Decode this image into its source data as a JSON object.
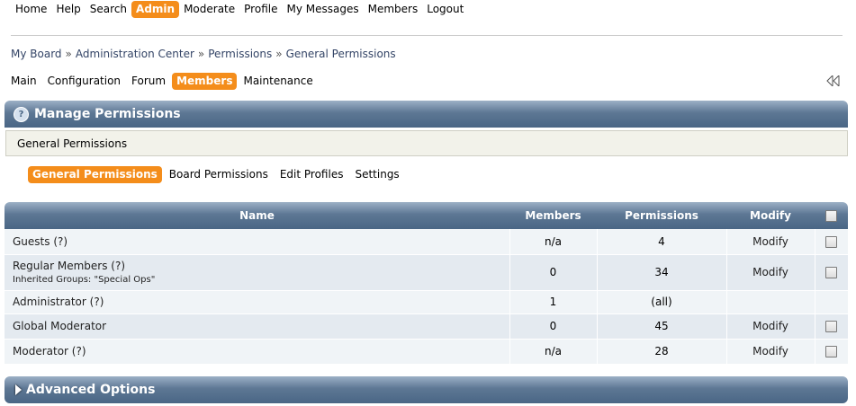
{
  "topnav": [
    {
      "label": "Home",
      "active": false
    },
    {
      "label": "Help",
      "active": false
    },
    {
      "label": "Search",
      "active": false
    },
    {
      "label": "Admin",
      "active": true
    },
    {
      "label": "Moderate",
      "active": false
    },
    {
      "label": "Profile",
      "active": false
    },
    {
      "label": "My Messages",
      "active": false
    },
    {
      "label": "Members",
      "active": false
    },
    {
      "label": "Logout",
      "active": false
    }
  ],
  "breadcrumb": [
    "My Board",
    "Administration Center",
    "Permissions",
    "General Permissions"
  ],
  "breadcrumb_separator": "»",
  "adminnav": [
    {
      "label": "Main",
      "active": false
    },
    {
      "label": "Configuration",
      "active": false
    },
    {
      "label": "Forum",
      "active": false
    },
    {
      "label": "Members",
      "active": true
    },
    {
      "label": "Maintenance",
      "active": false
    }
  ],
  "manage_bar": {
    "title": "Manage Permissions",
    "icon": "help-icon"
  },
  "info": {
    "text": "General Permissions"
  },
  "subnav": [
    {
      "label": "General Permissions",
      "active": true
    },
    {
      "label": "Board Permissions",
      "active": false
    },
    {
      "label": "Edit Profiles",
      "active": false
    },
    {
      "label": "Settings",
      "active": false
    }
  ],
  "table": {
    "headers": {
      "name": "Name",
      "members": "Members",
      "permissions": "Permissions",
      "modify": "Modify"
    },
    "rows": [
      {
        "name": "Guests",
        "help": "(?)",
        "sub": "",
        "members": "n/a",
        "permissions": "4",
        "modify": "Modify",
        "checkbox": true
      },
      {
        "name": "Regular Members",
        "help": "(?)",
        "sub": "Inherited Groups: \"Special Ops\"",
        "members": "0",
        "permissions": "34",
        "modify": "Modify",
        "checkbox": true
      },
      {
        "name": "Administrator",
        "help": "(?)",
        "sub": "",
        "members": "1",
        "permissions": "(all)",
        "modify": "",
        "checkbox": false
      },
      {
        "name": "Global Moderator",
        "help": "",
        "sub": "",
        "members": "0",
        "permissions": "45",
        "modify": "Modify",
        "checkbox": true
      },
      {
        "name": "Moderator",
        "help": "(?)",
        "sub": "",
        "members": "n/a",
        "permissions": "28",
        "modify": "Modify",
        "checkbox": true
      }
    ]
  },
  "advanced_bar": {
    "title": "Advanced Options",
    "icon": "expand-triangle-icon"
  },
  "colors": {
    "accent": "#f48d1b",
    "header": "#4a6685",
    "row_light": "#f0f4f7",
    "row_dark": "#e4eaf0"
  }
}
